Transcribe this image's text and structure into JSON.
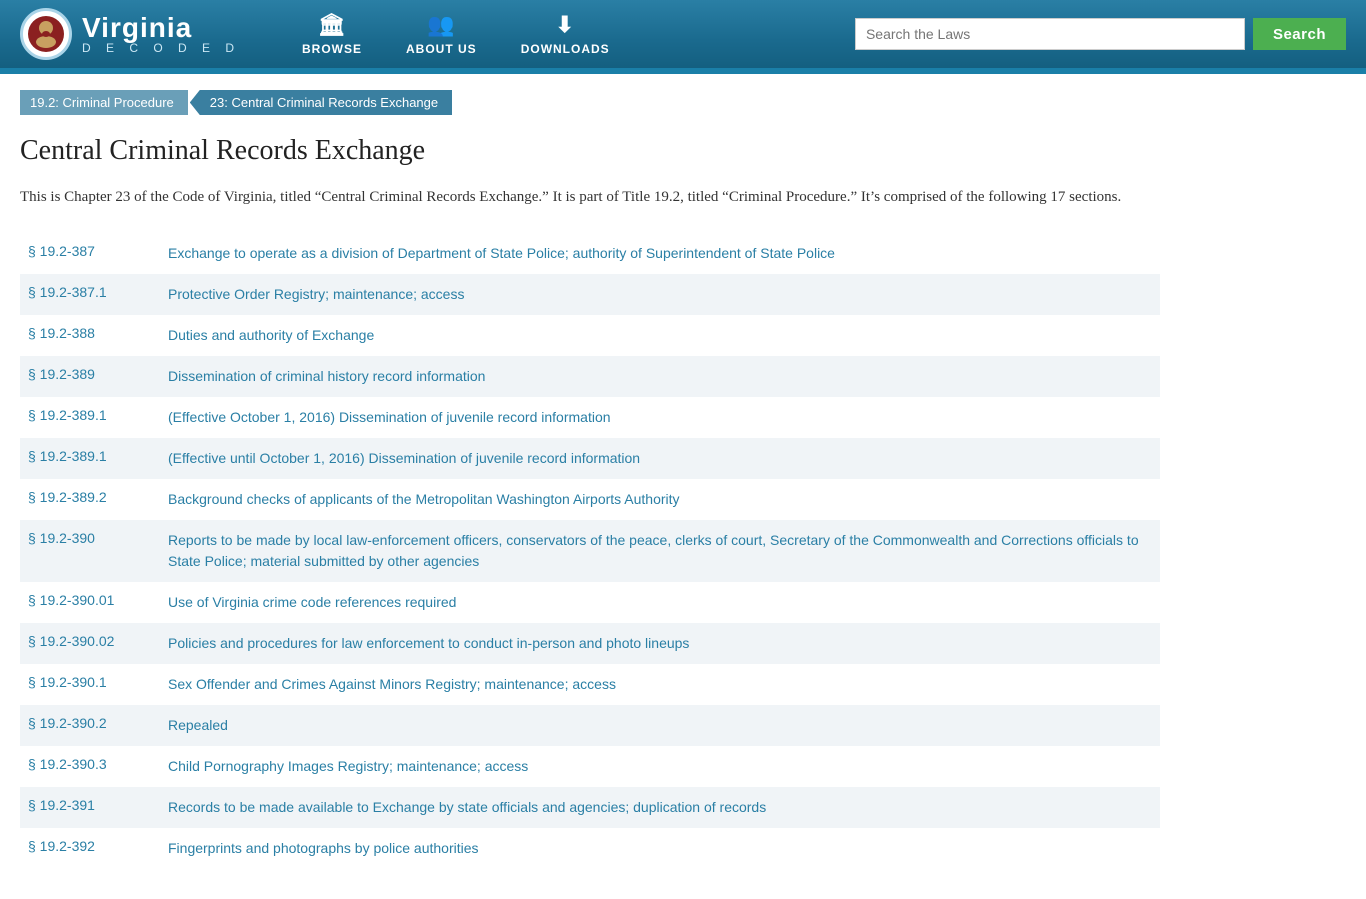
{
  "header": {
    "site_name": "Virginia",
    "site_subtitle": "D E C O D E D",
    "nav": [
      {
        "id": "browse",
        "label": "BROWSE",
        "icon": "🏛"
      },
      {
        "id": "about",
        "label": "ABOUT US",
        "icon": "👥"
      },
      {
        "id": "downloads",
        "label": "DOWNLOADS",
        "icon": "⬇"
      }
    ],
    "search_placeholder": "Search the Laws",
    "search_button_label": "Search"
  },
  "breadcrumb": [
    {
      "id": "bc1",
      "label": "19.2: Criminal Procedure",
      "href": "#"
    },
    {
      "id": "bc2",
      "label": "23: Central Criminal Records Exchange",
      "href": "#"
    }
  ],
  "page": {
    "title": "Central Criminal Records Exchange",
    "intro": "This is Chapter 23 of the Code of Virginia, titled “Central Criminal Records Exchange.” It is part of Title 19.2, titled “Criminal Procedure.” It’s comprised of the following 17 sections."
  },
  "sections": [
    {
      "number": "§ 19.2-387",
      "title": "Exchange to operate as a division of Department of State Police; authority of Superintendent of State Police",
      "shaded": false
    },
    {
      "number": "§ 19.2-387.1",
      "title": "Protective Order Registry; maintenance; access",
      "shaded": true
    },
    {
      "number": "§ 19.2-388",
      "title": "Duties and authority of Exchange",
      "shaded": false
    },
    {
      "number": "§ 19.2-389",
      "title": "Dissemination of criminal history record information",
      "shaded": true
    },
    {
      "number": "§ 19.2-389.1",
      "title": "(Effective October 1, 2016) Dissemination of juvenile record information",
      "shaded": false
    },
    {
      "number": "§ 19.2-389.1",
      "title": "(Effective until October 1, 2016) Dissemination of juvenile record information",
      "shaded": true
    },
    {
      "number": "§ 19.2-389.2",
      "title": "Background checks of applicants of the Metropolitan Washington Airports Authority",
      "shaded": false
    },
    {
      "number": "§ 19.2-390",
      "title": "Reports to be made by local law-enforcement officers, conservators of the peace, clerks of court, Secretary of the Commonwealth and Corrections officials to State Police; material submitted by other agencies",
      "shaded": true
    },
    {
      "number": "§ 19.2-390.01",
      "title": "Use of Virginia crime code references required",
      "shaded": false
    },
    {
      "number": "§ 19.2-390.02",
      "title": "Policies and procedures for law enforcement to conduct in-person and photo lineups",
      "shaded": true
    },
    {
      "number": "§ 19.2-390.1",
      "title": "Sex Offender and Crimes Against Minors Registry; maintenance; access",
      "shaded": false
    },
    {
      "number": "§ 19.2-390.2",
      "title": "Repealed",
      "shaded": true
    },
    {
      "number": "§ 19.2-390.3",
      "title": "Child Pornography Images Registry; maintenance; access",
      "shaded": false
    },
    {
      "number": "§ 19.2-391",
      "title": "Records to be made available to Exchange by state officials and agencies; duplication of records",
      "shaded": true
    },
    {
      "number": "§ 19.2-392",
      "title": "Fingerprints and photographs by police authorities",
      "shaded": false
    }
  ]
}
